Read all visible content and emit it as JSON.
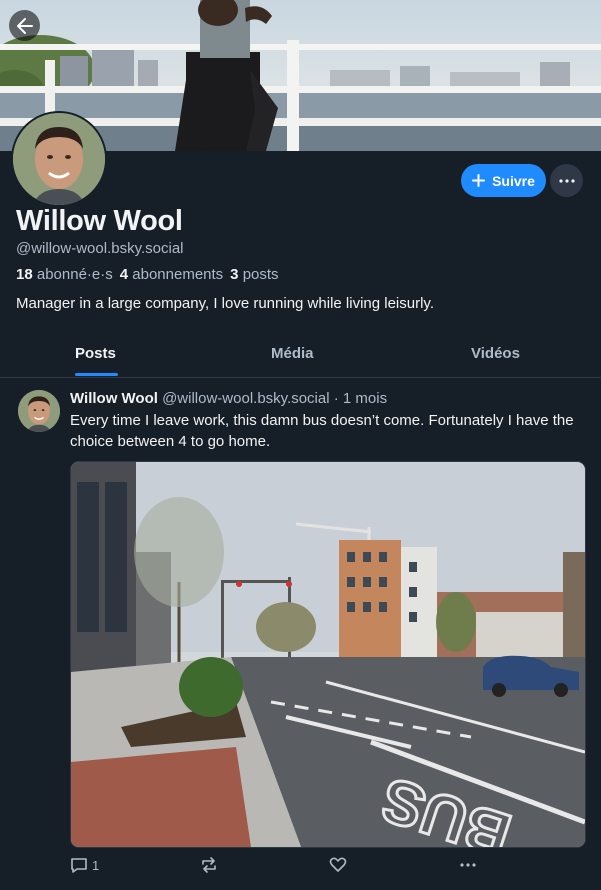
{
  "profile": {
    "display_name": "Willow Wool",
    "handle": "@willow-wool.bsky.social",
    "followers_count": "18",
    "followers_label": "abonné·e·s",
    "following_count": "4",
    "following_label": "abonnements",
    "posts_count": "3",
    "posts_label": "posts",
    "bio": "Manager in a large company, I love running while living leisurly."
  },
  "header": {
    "back_icon": "arrow-left-icon",
    "follow_label": "Suivre",
    "follow_icon": "plus-icon",
    "more_icon": "ellipsis-icon"
  },
  "tabs": [
    {
      "label": "Posts",
      "active": true
    },
    {
      "label": "Média",
      "active": false
    },
    {
      "label": "Vidéos",
      "active": false
    }
  ],
  "post": {
    "author": "Willow Wool",
    "handle": "@willow-wool.bsky.social",
    "separator": "·",
    "time": "1 mois",
    "text": "Every time I leave work, this damn bus doesn’t come. Fortunately I have the choice between 4 to go home.",
    "reply_count": "1",
    "road_marking": "BUS"
  },
  "colors": {
    "background": "#161e27",
    "accent": "#208bfe",
    "text_primary": "#f1f3f5",
    "text_secondary": "#aebbc9",
    "border": "#2e3847"
  }
}
